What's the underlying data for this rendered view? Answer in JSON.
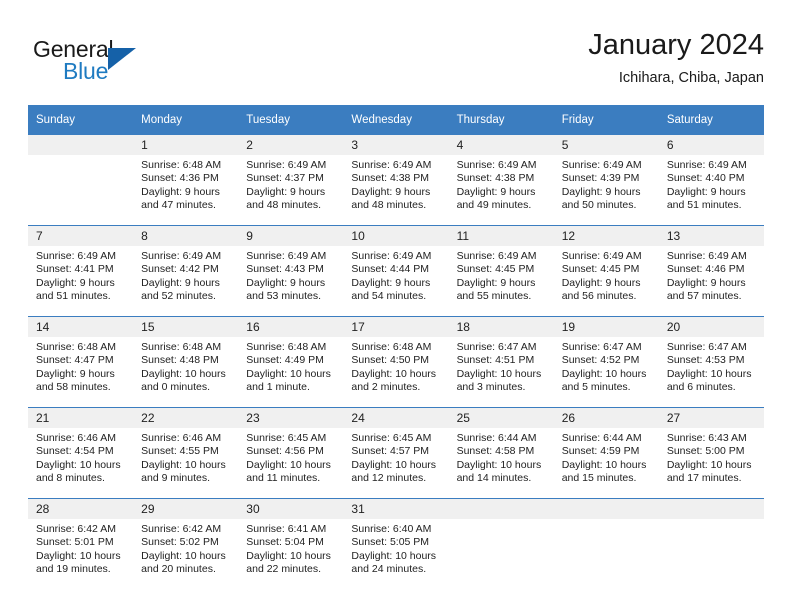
{
  "brand": {
    "name_top": "General",
    "name_bottom": "Blue",
    "accent_color": "#1f7bc1",
    "triangle_color": "#1561a8"
  },
  "header": {
    "title": "January 2024",
    "subtitle": "Ichihara, Chiba, Japan"
  },
  "calendar": {
    "header_bg": "#3b7dc0",
    "daynum_bg": "#f0f0f0",
    "weekdays": [
      "Sunday",
      "Monday",
      "Tuesday",
      "Wednesday",
      "Thursday",
      "Friday",
      "Saturday"
    ],
    "weeks": [
      [
        {
          "day": "",
          "sunrise": "",
          "sunset": "",
          "daylight1": "",
          "daylight2": ""
        },
        {
          "day": "1",
          "sunrise": "Sunrise: 6:48 AM",
          "sunset": "Sunset: 4:36 PM",
          "daylight1": "Daylight: 9 hours",
          "daylight2": "and 47 minutes."
        },
        {
          "day": "2",
          "sunrise": "Sunrise: 6:49 AM",
          "sunset": "Sunset: 4:37 PM",
          "daylight1": "Daylight: 9 hours",
          "daylight2": "and 48 minutes."
        },
        {
          "day": "3",
          "sunrise": "Sunrise: 6:49 AM",
          "sunset": "Sunset: 4:38 PM",
          "daylight1": "Daylight: 9 hours",
          "daylight2": "and 48 minutes."
        },
        {
          "day": "4",
          "sunrise": "Sunrise: 6:49 AM",
          "sunset": "Sunset: 4:38 PM",
          "daylight1": "Daylight: 9 hours",
          "daylight2": "and 49 minutes."
        },
        {
          "day": "5",
          "sunrise": "Sunrise: 6:49 AM",
          "sunset": "Sunset: 4:39 PM",
          "daylight1": "Daylight: 9 hours",
          "daylight2": "and 50 minutes."
        },
        {
          "day": "6",
          "sunrise": "Sunrise: 6:49 AM",
          "sunset": "Sunset: 4:40 PM",
          "daylight1": "Daylight: 9 hours",
          "daylight2": "and 51 minutes."
        }
      ],
      [
        {
          "day": "7",
          "sunrise": "Sunrise: 6:49 AM",
          "sunset": "Sunset: 4:41 PM",
          "daylight1": "Daylight: 9 hours",
          "daylight2": "and 51 minutes."
        },
        {
          "day": "8",
          "sunrise": "Sunrise: 6:49 AM",
          "sunset": "Sunset: 4:42 PM",
          "daylight1": "Daylight: 9 hours",
          "daylight2": "and 52 minutes."
        },
        {
          "day": "9",
          "sunrise": "Sunrise: 6:49 AM",
          "sunset": "Sunset: 4:43 PM",
          "daylight1": "Daylight: 9 hours",
          "daylight2": "and 53 minutes."
        },
        {
          "day": "10",
          "sunrise": "Sunrise: 6:49 AM",
          "sunset": "Sunset: 4:44 PM",
          "daylight1": "Daylight: 9 hours",
          "daylight2": "and 54 minutes."
        },
        {
          "day": "11",
          "sunrise": "Sunrise: 6:49 AM",
          "sunset": "Sunset: 4:45 PM",
          "daylight1": "Daylight: 9 hours",
          "daylight2": "and 55 minutes."
        },
        {
          "day": "12",
          "sunrise": "Sunrise: 6:49 AM",
          "sunset": "Sunset: 4:45 PM",
          "daylight1": "Daylight: 9 hours",
          "daylight2": "and 56 minutes."
        },
        {
          "day": "13",
          "sunrise": "Sunrise: 6:49 AM",
          "sunset": "Sunset: 4:46 PM",
          "daylight1": "Daylight: 9 hours",
          "daylight2": "and 57 minutes."
        }
      ],
      [
        {
          "day": "14",
          "sunrise": "Sunrise: 6:48 AM",
          "sunset": "Sunset: 4:47 PM",
          "daylight1": "Daylight: 9 hours",
          "daylight2": "and 58 minutes."
        },
        {
          "day": "15",
          "sunrise": "Sunrise: 6:48 AM",
          "sunset": "Sunset: 4:48 PM",
          "daylight1": "Daylight: 10 hours",
          "daylight2": "and 0 minutes."
        },
        {
          "day": "16",
          "sunrise": "Sunrise: 6:48 AM",
          "sunset": "Sunset: 4:49 PM",
          "daylight1": "Daylight: 10 hours",
          "daylight2": "and 1 minute."
        },
        {
          "day": "17",
          "sunrise": "Sunrise: 6:48 AM",
          "sunset": "Sunset: 4:50 PM",
          "daylight1": "Daylight: 10 hours",
          "daylight2": "and 2 minutes."
        },
        {
          "day": "18",
          "sunrise": "Sunrise: 6:47 AM",
          "sunset": "Sunset: 4:51 PM",
          "daylight1": "Daylight: 10 hours",
          "daylight2": "and 3 minutes."
        },
        {
          "day": "19",
          "sunrise": "Sunrise: 6:47 AM",
          "sunset": "Sunset: 4:52 PM",
          "daylight1": "Daylight: 10 hours",
          "daylight2": "and 5 minutes."
        },
        {
          "day": "20",
          "sunrise": "Sunrise: 6:47 AM",
          "sunset": "Sunset: 4:53 PM",
          "daylight1": "Daylight: 10 hours",
          "daylight2": "and 6 minutes."
        }
      ],
      [
        {
          "day": "21",
          "sunrise": "Sunrise: 6:46 AM",
          "sunset": "Sunset: 4:54 PM",
          "daylight1": "Daylight: 10 hours",
          "daylight2": "and 8 minutes."
        },
        {
          "day": "22",
          "sunrise": "Sunrise: 6:46 AM",
          "sunset": "Sunset: 4:55 PM",
          "daylight1": "Daylight: 10 hours",
          "daylight2": "and 9 minutes."
        },
        {
          "day": "23",
          "sunrise": "Sunrise: 6:45 AM",
          "sunset": "Sunset: 4:56 PM",
          "daylight1": "Daylight: 10 hours",
          "daylight2": "and 11 minutes."
        },
        {
          "day": "24",
          "sunrise": "Sunrise: 6:45 AM",
          "sunset": "Sunset: 4:57 PM",
          "daylight1": "Daylight: 10 hours",
          "daylight2": "and 12 minutes."
        },
        {
          "day": "25",
          "sunrise": "Sunrise: 6:44 AM",
          "sunset": "Sunset: 4:58 PM",
          "daylight1": "Daylight: 10 hours",
          "daylight2": "and 14 minutes."
        },
        {
          "day": "26",
          "sunrise": "Sunrise: 6:44 AM",
          "sunset": "Sunset: 4:59 PM",
          "daylight1": "Daylight: 10 hours",
          "daylight2": "and 15 minutes."
        },
        {
          "day": "27",
          "sunrise": "Sunrise: 6:43 AM",
          "sunset": "Sunset: 5:00 PM",
          "daylight1": "Daylight: 10 hours",
          "daylight2": "and 17 minutes."
        }
      ],
      [
        {
          "day": "28",
          "sunrise": "Sunrise: 6:42 AM",
          "sunset": "Sunset: 5:01 PM",
          "daylight1": "Daylight: 10 hours",
          "daylight2": "and 19 minutes."
        },
        {
          "day": "29",
          "sunrise": "Sunrise: 6:42 AM",
          "sunset": "Sunset: 5:02 PM",
          "daylight1": "Daylight: 10 hours",
          "daylight2": "and 20 minutes."
        },
        {
          "day": "30",
          "sunrise": "Sunrise: 6:41 AM",
          "sunset": "Sunset: 5:04 PM",
          "daylight1": "Daylight: 10 hours",
          "daylight2": "and 22 minutes."
        },
        {
          "day": "31",
          "sunrise": "Sunrise: 6:40 AM",
          "sunset": "Sunset: 5:05 PM",
          "daylight1": "Daylight: 10 hours",
          "daylight2": "and 24 minutes."
        },
        {
          "day": "",
          "sunrise": "",
          "sunset": "",
          "daylight1": "",
          "daylight2": ""
        },
        {
          "day": "",
          "sunrise": "",
          "sunset": "",
          "daylight1": "",
          "daylight2": ""
        },
        {
          "day": "",
          "sunrise": "",
          "sunset": "",
          "daylight1": "",
          "daylight2": ""
        }
      ]
    ]
  }
}
